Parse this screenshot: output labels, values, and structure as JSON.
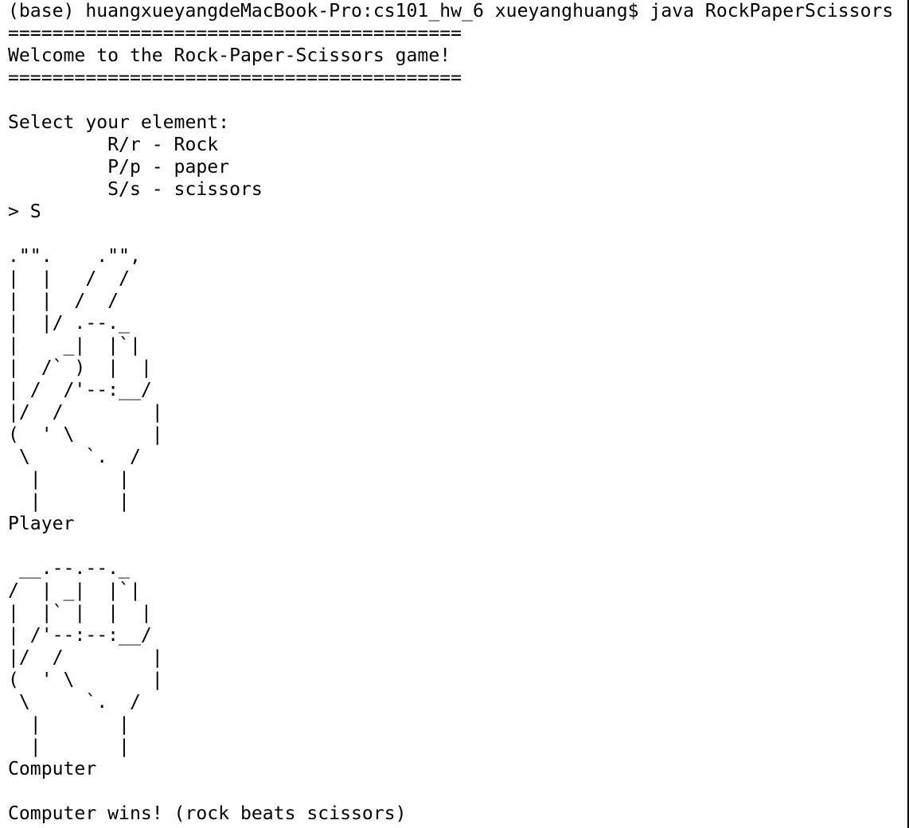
{
  "terminal": {
    "lines": [
      "(base) huangxueyangdeMacBook-Pro:cs101_hw_6 xueyanghuang$ java RockPaperScissors",
      "=========================================",
      "Welcome to the Rock-Paper-Scissors game!",
      "=========================================",
      "",
      "Select your element:",
      "         R/r - Rock",
      "         P/p - paper",
      "         S/s - scissors",
      "> S",
      "",
      ".\"\".    .\"\",",
      "|  |   /  /",
      "|  |  /  /",
      "|  |/ .--._",
      "|    _|  |`|",
      "|  /` )  |  |",
      "| /  /'--:__/",
      "|/  /        |",
      "(  ' \\       |",
      " \\     `.  /",
      "  |       |",
      "  |       |",
      "Player",
      "",
      " __.--.--._",
      "/  | _|  |`|",
      "|  |` |  |  |",
      "| /'--:--:__/",
      "|/  /        |",
      "(  ' \\       |",
      " \\     `.  /",
      "  |       |",
      "  |       |",
      "Computer",
      "",
      "Computer wins! (rock beats scissors)"
    ]
  }
}
